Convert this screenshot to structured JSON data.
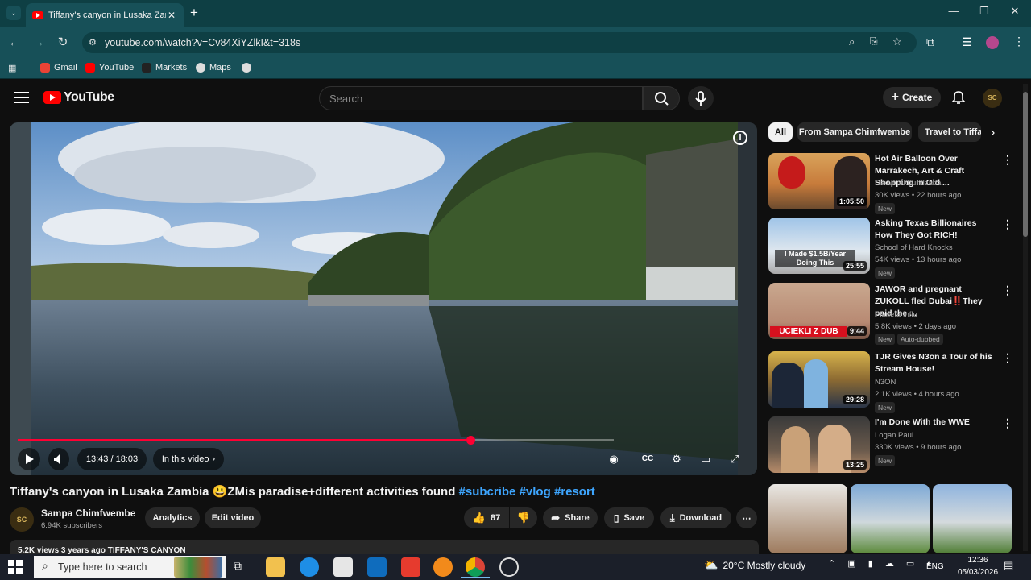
{
  "browser": {
    "tab_title": "Tiffany's canyon in Lusaka Zam",
    "tab_close": "✕",
    "new_tab": "+",
    "url": "youtube.com/watch?v=Cv84XiYZlkI&t=318s",
    "bookmarks": [
      {
        "label": "Gmail"
      },
      {
        "label": "YouTube"
      },
      {
        "label": "Markets"
      },
      {
        "label": "Maps"
      }
    ],
    "window_controls": {
      "minimize": "—",
      "maximize": "❐",
      "close": "✕"
    }
  },
  "youtube": {
    "logo_text": "YouTube",
    "search_placeholder": "Search",
    "create_label": "Create",
    "avatar_initials": "SC"
  },
  "player": {
    "time_display": "13:43 / 18:03",
    "in_this_video": "In this video",
    "progress_fraction": 0.76,
    "buffer_fraction": 1.0
  },
  "video": {
    "title": "Tiffany's canyon in Lusaka Zambia 😃ZMis paradise+different activities found",
    "hashtags": [
      "#subcribe",
      "#vlog",
      "#resort"
    ],
    "channel_name": "Sampa Chimfwembe",
    "channel_initials": "SC",
    "subscribers": "6.94K subscribers",
    "analytics_label": "Analytics",
    "edit_label": "Edit video",
    "likes": "87",
    "share_label": "Share",
    "save_label": "Save",
    "download_label": "Download",
    "description_preview": "5.2K views  3 years ago  TIFFANY'S CANYON"
  },
  "sidebar": {
    "chips": [
      "All",
      "From Sampa Chimfwembe",
      "Travel to Tiffa"
    ],
    "recommendations": [
      {
        "title": "Hot Air Balloon Over Marrakech, Art & Craft Shopping In Old ...",
        "channel": "Davud Akhundzada",
        "meta": "30K views • 22 hours ago",
        "badge": "New",
        "duration": "1:05:50"
      },
      {
        "title": "Asking Texas Billionaires How They Got RICH!",
        "channel": "School of Hard Knocks",
        "meta": "54K views • 13 hours ago",
        "badge": "New",
        "duration": "25:55",
        "thumb_text": "I Made $1.5B/Year Doing This"
      },
      {
        "title": "JAWOR and pregnant ZUKOLL fled Dubai‼️They paid the ...",
        "channel": "Planeta Influ",
        "meta": "5.8K views • 2 days ago",
        "badge": "New",
        "badge2": "Auto-dubbed",
        "duration": "9:44",
        "thumb_text": "UCIEKLI Z DUB"
      },
      {
        "title": "TJR Gives N3on a Tour of his Stream House!",
        "channel": "N3ON",
        "meta": "2.1K views • 4 hours ago",
        "badge": "New",
        "duration": "29:28"
      },
      {
        "title": "I'm Done With the WWE",
        "channel": "Logan Paul",
        "meta": "330K views • 9 hours ago",
        "badge": "New",
        "duration": "13:25"
      }
    ]
  },
  "taskbar": {
    "search_placeholder": "Type here to search",
    "weather": "20°C  Mostly cloudy",
    "language": "ENG",
    "time": "12:36",
    "date": "05/03/2026"
  }
}
